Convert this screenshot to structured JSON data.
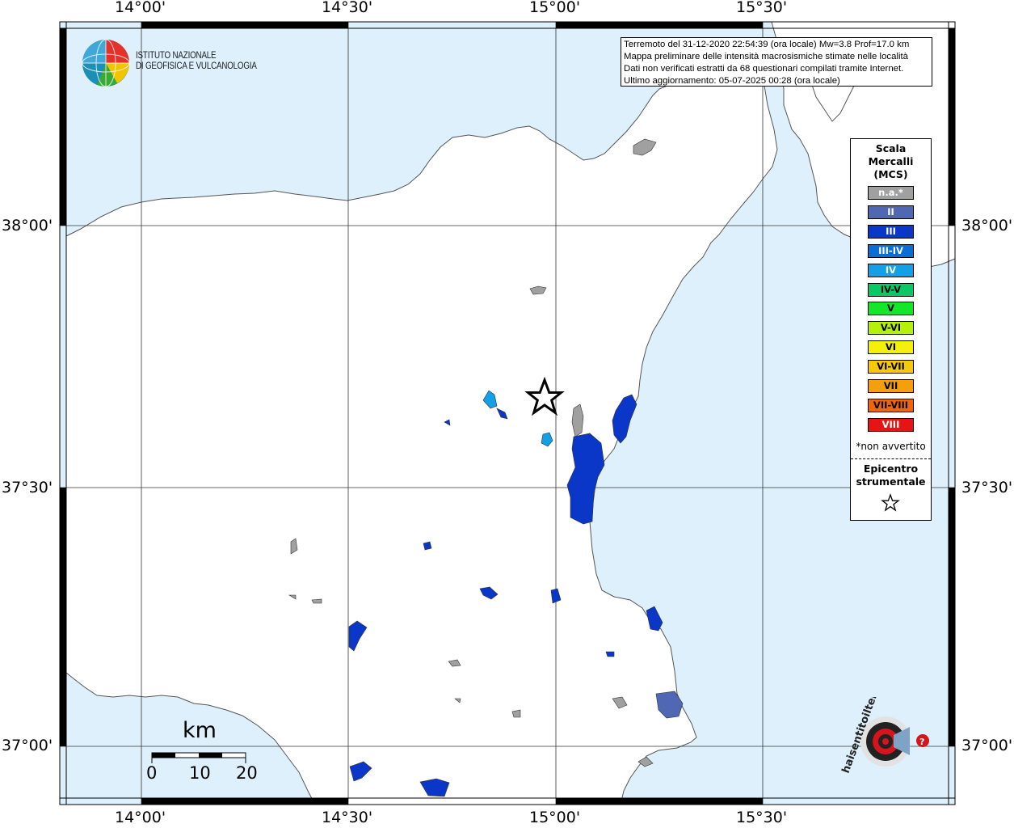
{
  "axes": {
    "lon_labels": [
      "14°00'",
      "14°30'",
      "15°00'",
      "15°30'"
    ],
    "lat_labels": [
      "38°00'",
      "37°30'",
      "37°00'"
    ]
  },
  "info": {
    "line1": "Terremoto del 31-12-2020 22:54:39 (ora locale) Mw=3.8 Prof=17.0 km",
    "line2": "Mappa preliminare delle intensità macrosismiche stimate nelle località",
    "line3": "Dati non verificati estratti da 68 questionari compilati tramite Internet.",
    "line4": "Ultimo aggiornamento: 05-07-2025 00:28 (ora locale)"
  },
  "institute": {
    "line1": "ISTITUTO NAZIONALE",
    "line2": "DI GEOFISICA E VULCANOLOGIA"
  },
  "legend": {
    "title_line1": "Scala",
    "title_line2": "Mercalli",
    "title_line3": "(MCS)",
    "items": [
      {
        "label": "n.a.*",
        "color": "#a0a0a0"
      },
      {
        "label": "II",
        "color": "#5068b4"
      },
      {
        "label": "III",
        "color": "#0a37c8"
      },
      {
        "label": "III-IV",
        "color": "#0a6ed2"
      },
      {
        "label": "IV",
        "color": "#14a0e6"
      },
      {
        "label": "IV-V",
        "color": "#0ac864"
      },
      {
        "label": "V",
        "color": "#14e628"
      },
      {
        "label": "V-VI",
        "color": "#b4f00a"
      },
      {
        "label": "VI",
        "color": "#f5f00a"
      },
      {
        "label": "VI-VII",
        "color": "#f5c80a"
      },
      {
        "label": "VII",
        "color": "#f5a00a"
      },
      {
        "label": "VII-VIII",
        "color": "#f0640a"
      },
      {
        "label": "VIII",
        "color": "#e61414"
      }
    ],
    "note": "*non avvertito",
    "epicenter_line1": "Epicentro",
    "epicenter_line2": "strumentale"
  },
  "scale_bar": {
    "unit": "km",
    "ticks": [
      "0",
      "10",
      "20"
    ]
  },
  "watermark": {
    "text": "haisentitoilterremoto.it www."
  },
  "colors": {
    "sea": "#ddf0fc",
    "land": "#ffffff",
    "coast": "#555555"
  }
}
